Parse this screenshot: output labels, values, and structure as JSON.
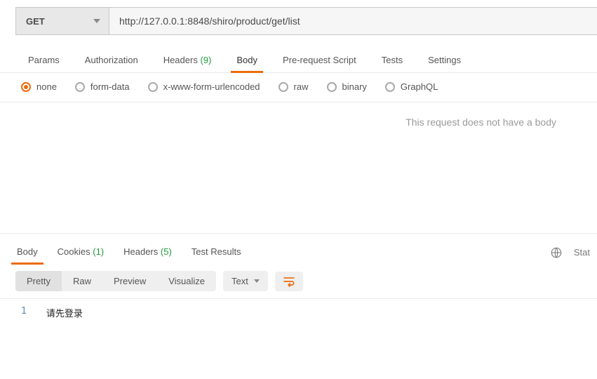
{
  "request": {
    "method": "GET",
    "url": "http://127.0.0.1:8848/shiro/product/get/list"
  },
  "reqTabs": {
    "params": "Params",
    "authorization": "Authorization",
    "headers_label": "Headers",
    "headers_count": "(9)",
    "body": "Body",
    "prerequest": "Pre-request Script",
    "tests": "Tests",
    "settings": "Settings"
  },
  "bodyTypes": {
    "none": "none",
    "formdata": "form-data",
    "xwww": "x-www-form-urlencoded",
    "raw": "raw",
    "binary": "binary",
    "graphql": "GraphQL"
  },
  "bodyPanel": {
    "empty_msg": "This request does not have a body"
  },
  "resTabs": {
    "body": "Body",
    "cookies_label": "Cookies",
    "cookies_count": "(1)",
    "headers_label": "Headers",
    "headers_count": "(5)",
    "test_results": "Test Results"
  },
  "resRight": {
    "status_label": "Stat"
  },
  "viewModes": {
    "pretty": "Pretty",
    "raw": "Raw",
    "preview": "Preview",
    "visualize": "Visualize"
  },
  "lang": {
    "text": "Text"
  },
  "responseBody": {
    "line1_no": "1",
    "line1_text": "请先登录"
  }
}
